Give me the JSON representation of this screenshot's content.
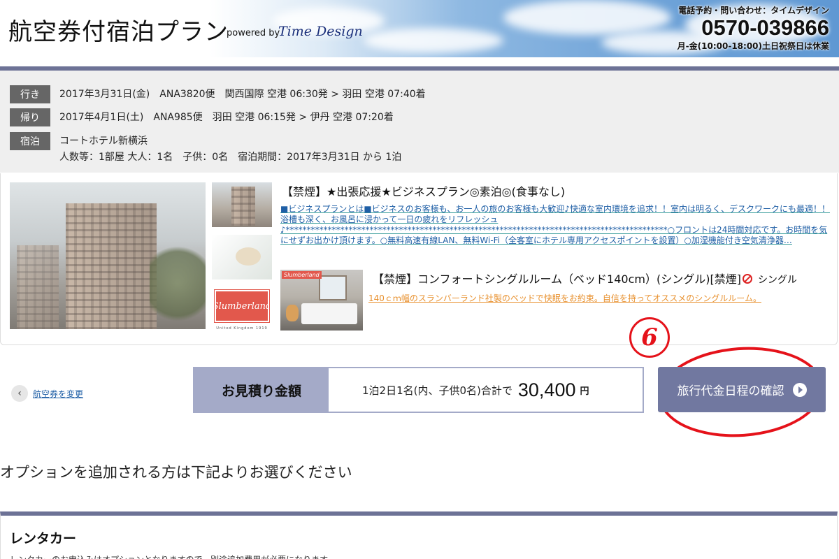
{
  "header": {
    "title": "航空券付宿泊プラン",
    "powered_by": "powered by",
    "brand": "Time Design",
    "contact_label": "電話予約・問い合わせ：タイムデザイン",
    "phone": "0570-039866",
    "hours": "月-金(10:00-18:00)土日祝祭日は休業"
  },
  "itinerary": {
    "outbound": {
      "tag": "行き",
      "text": "2017年3月31日(金)　ANA3820便　関西国際 空港 06:30発 > 羽田 空港 07:40着"
    },
    "return": {
      "tag": "帰り",
      "text": "2017年4月1日(土)　ANA985便　羽田 空港 06:15発 > 伊丹 空港 07:20着"
    },
    "stay": {
      "tag": "宿泊",
      "hotel": "コートホテル新横浜",
      "details": "人数等：1部屋 大人：1名　子供：0名　宿泊期間：2017年3月31日 から 1泊"
    }
  },
  "plan": {
    "title": "【禁煙】★出張応援★ビジネスプラン◎素泊◎(食事なし)",
    "description": "■ビジネスプランとは■ビジネスのお客様も、お一人の旅のお客様も大歓迎♪快適な室内環境を追求！！室内は明るく、デスクワークにも最適！！浴槽も深く、お風呂に浸かって一日の疲れをリフレッシュ♪*******************************************************************************************○フロントは24時間対応です。お時間を気にせずお出かけ頂けます。○無料高速有線LAN、無料Wi-Fi（全客室にホテル専用アクセスポイントを設置）○加湿機能付き空気清浄器…",
    "room_title": "【禁煙】コンフォートシングルルーム（ベッド140cm）(シングル)[禁煙]",
    "room_type": "シングル",
    "room_description": "140ｃｍ幅のスランバーランド社製のベッドで快眠をお約束。自信を持ってオススメのシングルルーム。",
    "thumb_logo": "Slumberland",
    "thumb_logo_sub": "United Kingdom 1919",
    "room_logo": "Slumberland"
  },
  "estimate": {
    "back_label": "航空券を変更",
    "label": "お見積り金額",
    "detail": "1泊2日1名(内、子供0名)合計で",
    "amount": "30,400",
    "currency": "円",
    "confirm_label": "旅行代金日程の確認"
  },
  "annotation": {
    "step": "6"
  },
  "options": {
    "heading": "オプションを追加される方は下記よりお選びください",
    "rental_title": "レンタカー",
    "rental_note": "レンタカーのお申込みはオプションとなりますので、別途追加費用が必要になります。"
  },
  "colors": {
    "accent": "#6d7296",
    "button": "#7178a0",
    "estimate_label_bg": "#a4aac8",
    "annotation_red": "#e5121a",
    "link_blue": "#1f5fa6",
    "link_orange": "#e8912f"
  }
}
